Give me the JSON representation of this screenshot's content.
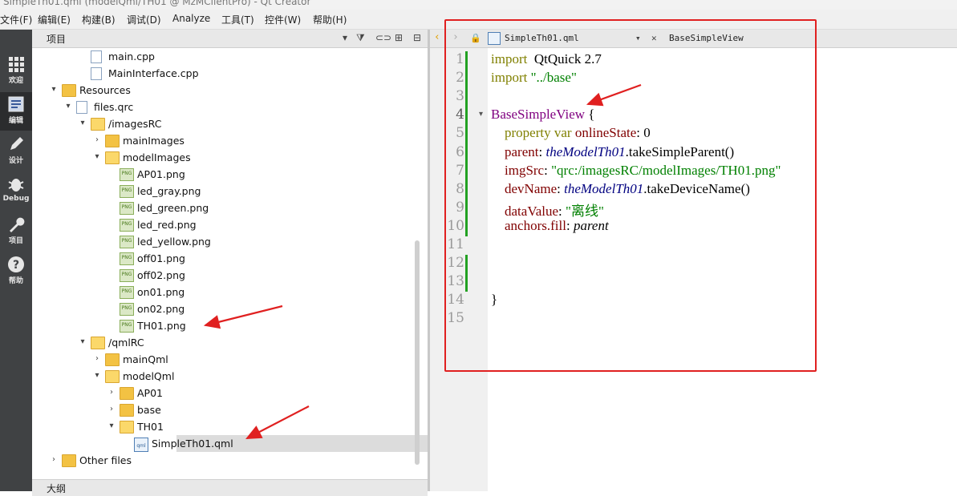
{
  "window": {
    "title": "SimpleTh01.qml (modelQml/TH01 @ MzMClientPro) - Qt Creator"
  },
  "menu": [
    "文件(F)",
    "编辑(E)",
    "构建(B)",
    "调试(D)",
    "Analyze",
    "工具(T)",
    "控件(W)",
    "帮助(H)"
  ],
  "modes": [
    {
      "label": "欢迎",
      "icon": "grid-icon"
    },
    {
      "label": "编辑",
      "icon": "edit-doc-icon",
      "active": true
    },
    {
      "label": "设计",
      "icon": "pencil-icon"
    },
    {
      "label": "Debug",
      "icon": "bug-icon"
    },
    {
      "label": "项目",
      "icon": "wrench-icon"
    },
    {
      "label": "帮助",
      "icon": "help-icon"
    }
  ],
  "project_panel": {
    "title": "项目"
  },
  "outline_panel": {
    "title": "大纲"
  },
  "tree": [
    {
      "name": "main.cpp",
      "indent": 3,
      "kind": "cpp",
      "arrow": ""
    },
    {
      "name": "MainInterface.cpp",
      "indent": 3,
      "kind": "cpp",
      "arrow": ""
    },
    {
      "name": "Resources",
      "indent": 1,
      "kind": "res",
      "arrow": "▾"
    },
    {
      "name": "files.qrc",
      "indent": 2,
      "kind": "qrc",
      "arrow": "▾"
    },
    {
      "name": "/imagesRC",
      "indent": 3,
      "kind": "folder-open",
      "arrow": "▾"
    },
    {
      "name": "mainImages",
      "indent": 4,
      "kind": "folder",
      "arrow": "›"
    },
    {
      "name": "modelImages",
      "indent": 4,
      "kind": "folder-open",
      "arrow": "▾"
    },
    {
      "name": "AP01.png",
      "indent": 5,
      "kind": "png",
      "arrow": ""
    },
    {
      "name": "led_gray.png",
      "indent": 5,
      "kind": "png",
      "arrow": ""
    },
    {
      "name": "led_green.png",
      "indent": 5,
      "kind": "png",
      "arrow": ""
    },
    {
      "name": "led_red.png",
      "indent": 5,
      "kind": "png",
      "arrow": ""
    },
    {
      "name": "led_yellow.png",
      "indent": 5,
      "kind": "png",
      "arrow": ""
    },
    {
      "name": "off01.png",
      "indent": 5,
      "kind": "png",
      "arrow": ""
    },
    {
      "name": "off02.png",
      "indent": 5,
      "kind": "png",
      "arrow": ""
    },
    {
      "name": "on01.png",
      "indent": 5,
      "kind": "png",
      "arrow": ""
    },
    {
      "name": "on02.png",
      "indent": 5,
      "kind": "png",
      "arrow": ""
    },
    {
      "name": "TH01.png",
      "indent": 5,
      "kind": "png",
      "arrow": ""
    },
    {
      "name": "/qmlRC",
      "indent": 3,
      "kind": "folder-open",
      "arrow": "▾"
    },
    {
      "name": "mainQml",
      "indent": 4,
      "kind": "folder",
      "arrow": "›"
    },
    {
      "name": "modelQml",
      "indent": 4,
      "kind": "folder-open",
      "arrow": "▾"
    },
    {
      "name": "AP01",
      "indent": 5,
      "kind": "folder",
      "arrow": "›"
    },
    {
      "name": "base",
      "indent": 5,
      "kind": "folder",
      "arrow": "›"
    },
    {
      "name": "TH01",
      "indent": 5,
      "kind": "folder-open",
      "arrow": "▾"
    },
    {
      "name": "SimpleTh01.qml",
      "indent": 6,
      "kind": "qml",
      "arrow": "",
      "selected": true
    },
    {
      "name": "Other files",
      "indent": 1,
      "kind": "other",
      "arrow": "›"
    }
  ],
  "editor": {
    "file_tab": "SimpleTh01.qml",
    "symbol": "BaseSimpleView",
    "current_line": 4,
    "lines": [
      [
        [
          "kw",
          "import"
        ],
        [
          "",
          "  QtQuick 2.7"
        ]
      ],
      [
        [
          "kw",
          "import"
        ],
        [
          "",
          ""
        ],
        [
          "str",
          " \"../base\""
        ]
      ],
      [],
      [
        [
          "type",
          "BaseSimpleView"
        ],
        [
          "",
          " {"
        ]
      ],
      [
        [
          "",
          "    "
        ],
        [
          "kw",
          "property var"
        ],
        [
          "",
          " "
        ],
        [
          "prop",
          "onlineState"
        ],
        [
          "",
          ": 0"
        ]
      ],
      [
        [
          "",
          "    "
        ],
        [
          "prop",
          "parent"
        ],
        [
          "",
          ": "
        ],
        [
          "id",
          "theModelTh01"
        ],
        [
          "",
          ".takeSimpleParent()"
        ]
      ],
      [
        [
          "",
          "    "
        ],
        [
          "prop",
          "imgSrc"
        ],
        [
          "",
          ": "
        ],
        [
          "str",
          "\"qrc:/imagesRC/modelImages/TH01.png\""
        ]
      ],
      [
        [
          "",
          "    "
        ],
        [
          "prop",
          "devName"
        ],
        [
          "",
          ": "
        ],
        [
          "id",
          "theModelTh01"
        ],
        [
          "",
          ".takeDeviceName()"
        ]
      ],
      [
        [
          "",
          "    "
        ],
        [
          "prop",
          "dataValue"
        ],
        [
          "",
          ": "
        ],
        [
          "str",
          "\"离线\""
        ]
      ],
      [
        [
          "",
          "    "
        ],
        [
          "prop",
          "anchors.fill"
        ],
        [
          "",
          ": "
        ],
        [
          "ital",
          "parent"
        ]
      ],
      [],
      [],
      [],
      [
        [
          "",
          "}"
        ]
      ],
      []
    ]
  },
  "colors": {
    "annotation": "#e02020",
    "modebar": "#404244",
    "modified_marker": "#22a122"
  }
}
